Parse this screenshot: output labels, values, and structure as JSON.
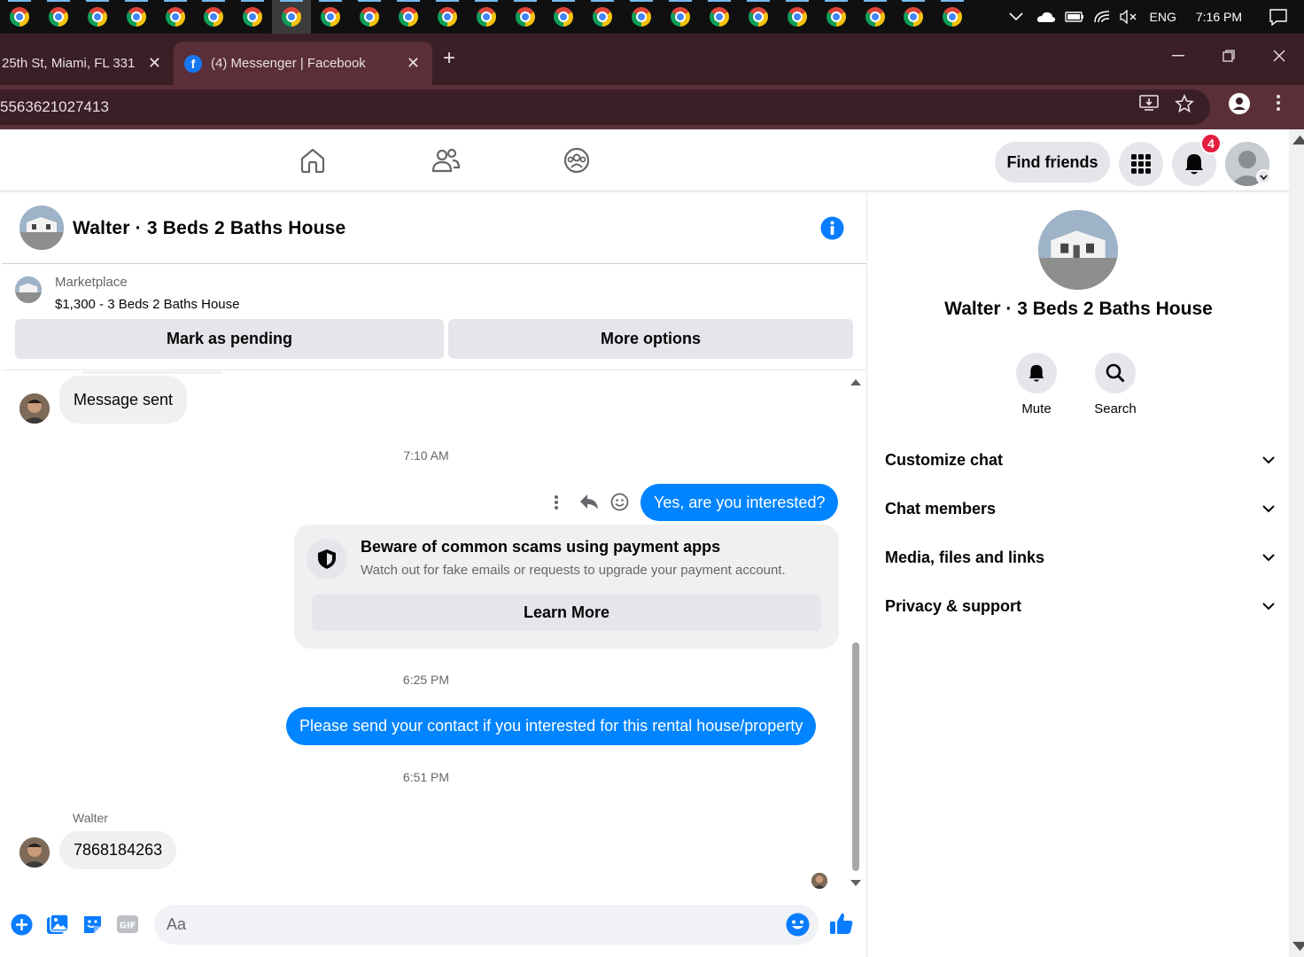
{
  "taskbar": {
    "app_count": 25,
    "active_index": 7,
    "language": "ENG",
    "time": "7:16 PM"
  },
  "browser": {
    "tab_inactive_title": "25th St, Miami, FL 331",
    "tab_active_title": "(4) Messenger | Facebook",
    "url_fragment": "5563621027413"
  },
  "fb_nav": {
    "find_friends": "Find friends",
    "notification_count": "4"
  },
  "chat": {
    "title": "Walter · 3 Beds 2 Baths House",
    "marketplace_label": "Marketplace",
    "listing": "$1,300 - 3 Beds 2 Baths House",
    "mark_pending": "Mark as pending",
    "more_options": "More options"
  },
  "messages": {
    "msg1": "Message sent",
    "ts1": "7:10 AM",
    "msg2": "Yes, are you interested?",
    "scam_title": "Beware of common scams using payment apps",
    "scam_sub": "Watch out for fake emails or requests to upgrade your payment account.",
    "learn_more": "Learn More",
    "ts2": "6:25 PM",
    "msg3": "Please send your contact if you interested for this rental house/property",
    "ts3": "6:51 PM",
    "sender": "Walter",
    "msg4": "7868184263"
  },
  "composer": {
    "placeholder": "Aa"
  },
  "right_panel": {
    "name": "Walter · 3 Beds 2 Baths House",
    "mute": "Mute",
    "search": "Search",
    "rows": [
      "Customize chat",
      "Chat members",
      "Media, files and links",
      "Privacy & support"
    ]
  },
  "colors": {
    "messenger_blue": "#0084ff",
    "fb_blue": "#1877f2",
    "badge_red": "#e41e3f"
  }
}
